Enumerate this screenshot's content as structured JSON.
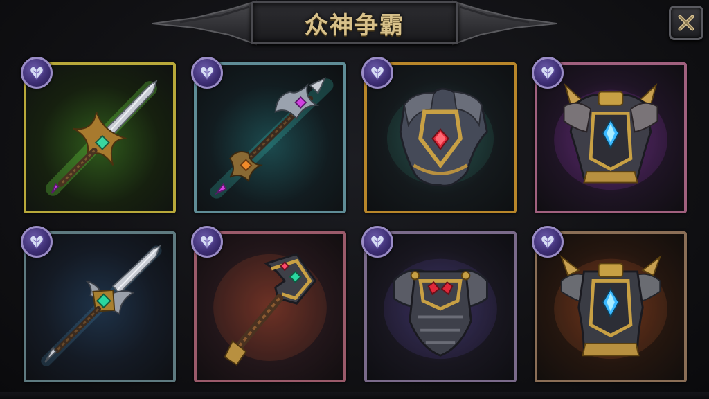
{
  "header": {
    "title": "众神争霸",
    "close_icon": "close-x-icon"
  },
  "colors": {
    "background": "#111114",
    "title_text": "#d8c18a",
    "badge_purple": "#3c2d72"
  },
  "items": [
    {
      "icon": "greatsword-icon",
      "frame": "#b8a83a",
      "glow": "#3f7a22",
      "badge_icon": "heart-shield-icon"
    },
    {
      "icon": "double-axe-icon",
      "frame": "#5f8c96",
      "glow": "#22595e",
      "badge_icon": "heart-shield-icon"
    },
    {
      "icon": "chest-armor-icon",
      "frame": "#b8862a",
      "glow": "#2a4a4c",
      "badge_icon": "heart-shield-icon"
    },
    {
      "icon": "spiked-chest-armor-icon",
      "frame": "#a0607e",
      "glow": "#5a2a6a",
      "badge_icon": "heart-shield-icon"
    },
    {
      "icon": "lance-icon",
      "frame": "#5e7a80",
      "glow": "#1e2c3e",
      "badge_icon": "heart-shield-icon"
    },
    {
      "icon": "warhammer-icon",
      "frame": "#9a5a6a",
      "glow": "#6a2a22",
      "badge_icon": "heart-shield-icon"
    },
    {
      "icon": "plate-armor-icon",
      "frame": "#7a6a8a",
      "glow": "#3a2a5a",
      "badge_icon": "heart-shield-icon"
    },
    {
      "icon": "spiked-plate-armor-icon",
      "frame": "#8a6e56",
      "glow": "#6a2e1a",
      "badge_icon": "heart-shield-icon"
    }
  ]
}
